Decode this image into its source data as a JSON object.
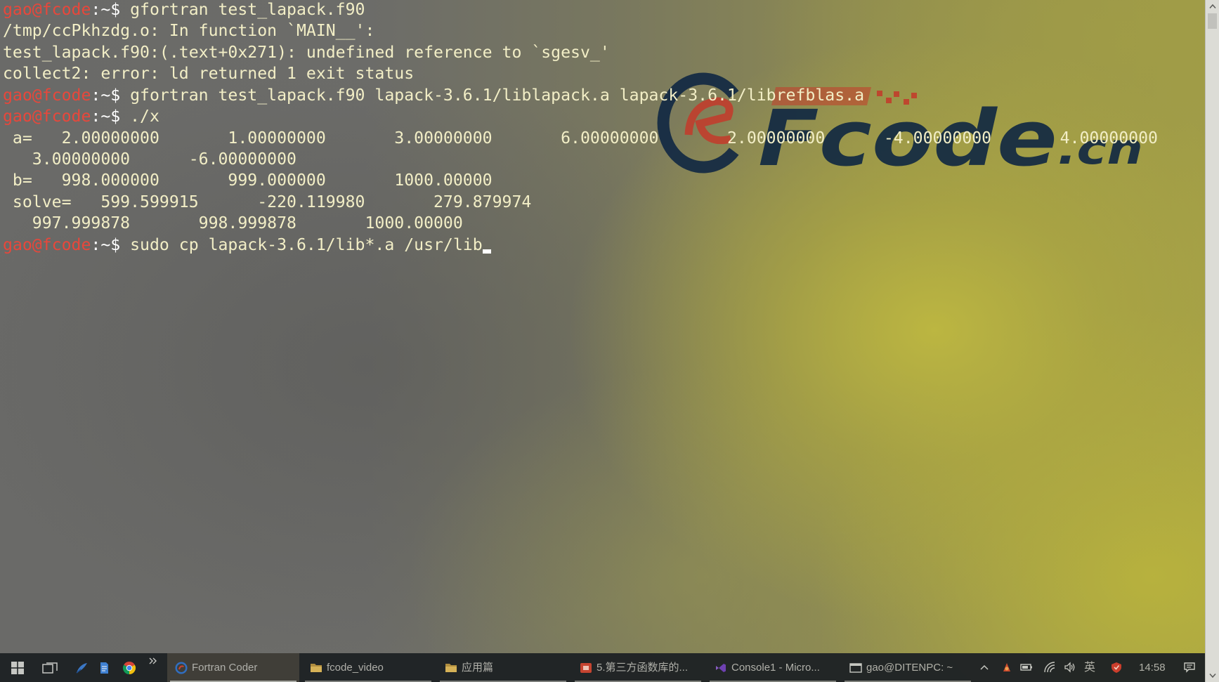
{
  "colors": {
    "terminal_text": "#f2eec6",
    "prompt_user": "#e8473b",
    "prompt_symbol": "#ffffff",
    "cursor": "#ffffff",
    "watermark_navy": "#0f2742",
    "watermark_red": "#c43a2a",
    "taskbar_bg": "#1f2325",
    "taskbar_text": "#b2b2ac"
  },
  "terminal": {
    "lines": [
      {
        "user": "gao@fcode",
        "sep": ":~$",
        "cmd": "gfortran test_lapack.f90"
      },
      "/tmp/ccPkhzdg.o: In function `MAIN__':",
      "test_lapack.f90:(.text+0x271): undefined reference to `sgesv_'",
      "collect2: error: ld returned 1 exit status",
      {
        "user": "gao@fcode",
        "sep": ":~$",
        "cmd": "gfortran test_lapack.f90 lapack-3.6.1/liblapack.a lapack-3.6.1/librefblas.a"
      },
      {
        "user": "gao@fcode",
        "sep": ":~$",
        "cmd": "./x"
      },
      " a=   2.00000000       1.00000000       3.00000000       6.00000000       2.00000000      -4.00000000       4.00000000",
      "   3.00000000      -6.00000000",
      " b=   998.000000       999.000000       1000.00000",
      " solve=   599.599915      -220.119980       279.879974",
      "   997.999878       998.999878       1000.00000",
      {
        "user": "gao@fcode",
        "sep": ":~$",
        "cmd": "sudo cp lapack-3.6.1/lib*.a /usr/lib"
      }
    ]
  },
  "watermark": {
    "brand": "Fcode",
    "suffix": ".cn"
  },
  "scrollbar": {
    "up_icon": "scroll-up-arrow-icon",
    "down_icon": "scroll-down-arrow-icon",
    "scroll_fraction": 0
  },
  "taskbar": {
    "start_icon": "windows-start-icon",
    "task_view_icon": "task-view-icon",
    "pinned_icons": [
      "bird-icon",
      "document-icon",
      "chrome-icon"
    ],
    "overflow_icon": "overflow-chevron-icon",
    "windows": [
      {
        "label": "Fortran Coder",
        "icon": "fcode-logo-icon",
        "active": true
      },
      {
        "label": "fcode_video",
        "icon": "folder-icon",
        "active": false
      },
      {
        "label": "应用篇",
        "icon": "folder-icon",
        "active": false
      },
      {
        "label": "5.第三方函数库的...",
        "icon": "presentation-icon",
        "active": false
      },
      {
        "label": "Console1 - Micro...",
        "icon": "visual-studio-icon",
        "active": false
      },
      {
        "label": "gao@DITENPC: ~",
        "icon": "terminal-icon",
        "active": false
      }
    ],
    "tray": {
      "icons": [
        "chevron-up-icon",
        "red-app-icon",
        "battery-icon",
        "wifi-icon",
        "volume-icon"
      ],
      "ime_label": "英",
      "security_icon": "security-app-icon",
      "clock": "14:58",
      "notification_icon": "notification-icon"
    }
  }
}
